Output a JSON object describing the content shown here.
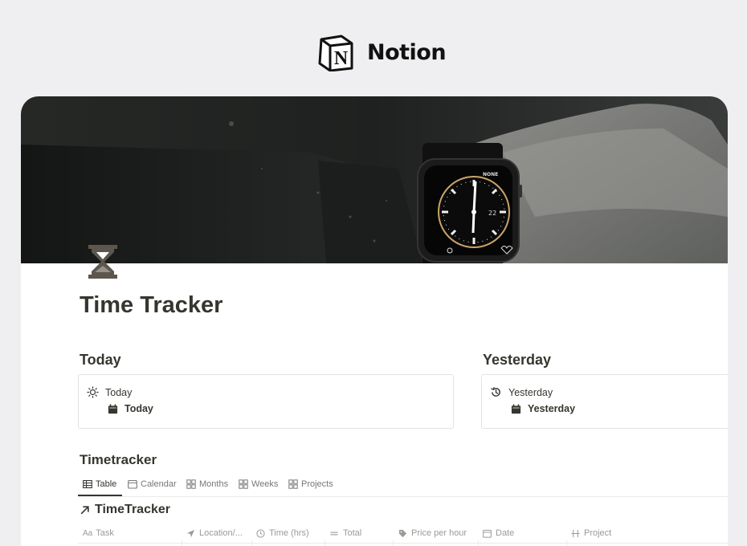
{
  "brand": {
    "name": "Notion"
  },
  "page": {
    "title": "Time Tracker",
    "icon": "hourglass-icon"
  },
  "cover": {
    "description_icon": "apple-watch-cover-photo"
  },
  "sections": {
    "today": {
      "heading": "Today",
      "item_label": "Today",
      "sub_label": "Today",
      "item_icon": "sun-icon",
      "sub_icon": "calendar-icon"
    },
    "yesterday": {
      "heading": "Yesterday",
      "item_label": "Yesterday",
      "sub_label": "Yesterday",
      "item_icon": "history-icon",
      "sub_icon": "calendar-icon"
    }
  },
  "timetracker": {
    "heading": "Timetracker",
    "tabs": [
      {
        "label": "Table",
        "icon": "table-icon",
        "active": true
      },
      {
        "label": "Calendar",
        "icon": "calendar-icon",
        "active": false
      },
      {
        "label": "Months",
        "icon": "grid-icon",
        "active": false
      },
      {
        "label": "Weeks",
        "icon": "grid-icon",
        "active": false
      },
      {
        "label": "Projects",
        "icon": "grid-icon",
        "active": false
      }
    ],
    "linked_db_title": "TimeTracker",
    "columns": [
      {
        "label": "Task",
        "icon": "text-icon"
      },
      {
        "label": "Location/...",
        "icon": "location-arrow-icon"
      },
      {
        "label": "Time (hrs)",
        "icon": "clock-icon"
      },
      {
        "label": "Total",
        "icon": "formula-icon"
      },
      {
        "label": "Price per hour",
        "icon": "tag-icon"
      },
      {
        "label": "Date",
        "icon": "calendar-icon"
      },
      {
        "label": "Project",
        "icon": "relation-icon"
      }
    ]
  },
  "colors": {
    "text": "#37352f",
    "muted": "#9b9a97",
    "background": "#efeff1",
    "border": "#e3e2e0"
  }
}
